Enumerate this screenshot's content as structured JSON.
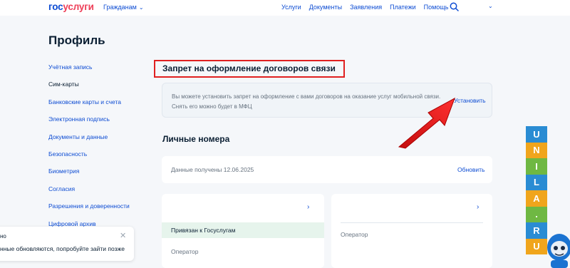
{
  "header": {
    "logo_part1": "гос",
    "logo_part2": "услуги",
    "audience": "Гражданам",
    "nav": [
      "Услуги",
      "Документы",
      "Заявления",
      "Платежи",
      "Помощь"
    ],
    "search_icon": "search-icon",
    "user_menu_icon": "chevron-down-icon"
  },
  "page_title": "Профиль",
  "sidebar": {
    "items": [
      {
        "label": "Учётная запись",
        "active": false
      },
      {
        "label": "Сим-карты",
        "active": true
      },
      {
        "label": "Банковские карты и счета",
        "active": false
      },
      {
        "label": "Электронная подпись",
        "active": false
      },
      {
        "label": "Документы и данные",
        "active": false
      },
      {
        "label": "Безопасность",
        "active": false
      },
      {
        "label": "Биометрия",
        "active": false
      },
      {
        "label": "Согласия",
        "active": false
      },
      {
        "label": "Разрешения и доверенности",
        "active": false
      },
      {
        "label": "Цифровой архив",
        "active": false
      }
    ]
  },
  "ban": {
    "title": "Запрет на оформление договоров связи",
    "description": "Вы можете установить запрет на оформление с вами договоров на оказание услуг мобильной связи. Снять его можно будет в МФЦ",
    "action": "Установить"
  },
  "numbers": {
    "title": "Личные номера",
    "data_date": "Данные получены 12.06.2025",
    "refresh": "Обновить",
    "cards": [
      {
        "bound_label": "Привязан к Госуслугам",
        "operator_label": "Оператор"
      },
      {
        "operator_label": "Оператор"
      }
    ]
  },
  "toast": {
    "title": "но",
    "message": "нные обновляются, попробуйте зайти позже",
    "close_icon": "close-icon"
  },
  "watermark": {
    "letters": [
      "U",
      "N",
      "I",
      "L",
      "A",
      ".",
      "R",
      "U"
    ],
    "colors": [
      "#2a8cd3",
      "#f0a51c",
      "#6fb843",
      "#2a8cd3",
      "#f0a51c",
      "#6fb843",
      "#2a8cd3",
      "#f0a51c"
    ]
  },
  "colors": {
    "accent": "#0d4cd3",
    "logo_red": "#ee3f58",
    "highlight_frame": "#e02020",
    "bound_bg": "#e6f4ec"
  }
}
